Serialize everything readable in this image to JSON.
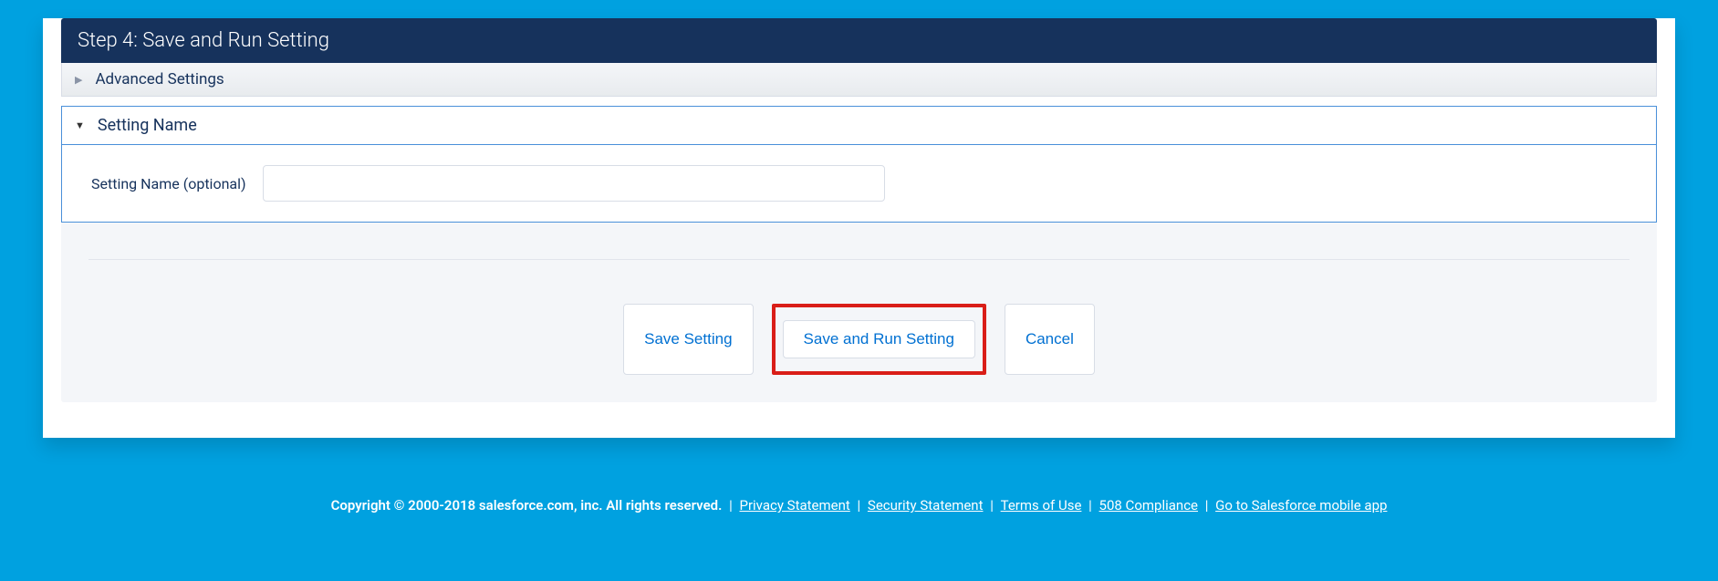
{
  "step_header": "Step 4: Save and Run Setting",
  "accordion": {
    "advanced_settings_label": "Advanced Settings",
    "setting_name_label": "Setting Name"
  },
  "form": {
    "setting_name_field_label": "Setting Name (optional)",
    "setting_name_value": ""
  },
  "buttons": {
    "save_setting": "Save Setting",
    "save_and_run": "Save and Run Setting",
    "cancel": "Cancel"
  },
  "footer": {
    "copyright": "Copyright © 2000-2018 salesforce.com, inc. All rights reserved.",
    "links": {
      "privacy": "Privacy Statement",
      "security": "Security Statement",
      "terms": "Terms of Use",
      "compliance": "508 Compliance",
      "mobile": "Go to Salesforce mobile app"
    }
  }
}
